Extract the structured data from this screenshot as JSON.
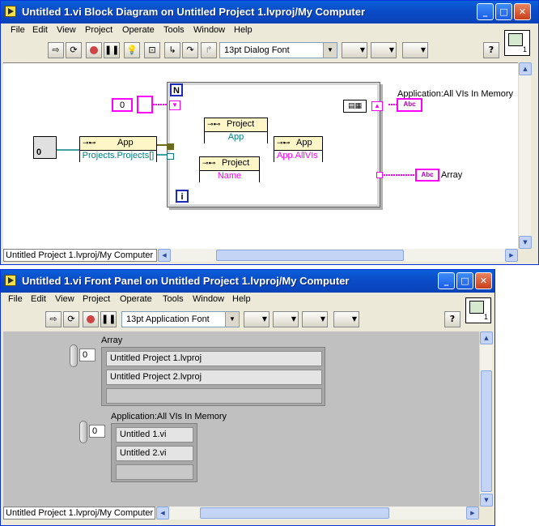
{
  "block_diagram_window": {
    "title": "Untitled 1.vi Block Diagram on Untitled Project 1.lvproj/My Computer",
    "menu": [
      "File",
      "Edit",
      "View",
      "Project",
      "Operate",
      "Tools",
      "Window",
      "Help"
    ],
    "font_select": "13pt Dialog Font",
    "vi_icon_number": "1",
    "status": "Untitled Project 1.lvproj/My Computer",
    "diagram": {
      "numeric_constant": "0",
      "app_node": {
        "class": "App",
        "property": "Projects.Projects[]"
      },
      "project_node_1": {
        "class": "Project",
        "property": "App"
      },
      "app_node_2": {
        "class": "App",
        "property": "App.AllVIs"
      },
      "project_node_2": {
        "class": "Project",
        "property": "Name"
      },
      "loop_count_terminal": "N",
      "loop_iteration_terminal": "i",
      "indicator_label_1": "Application:All VIs In Memory",
      "indicator_label_2": "Array",
      "string_indicator_text": "Abc",
      "app_ref_constant": "0"
    }
  },
  "front_panel_window": {
    "title": "Untitled 1.vi Front Panel on Untitled Project 1.lvproj/My Computer",
    "menu": [
      "File",
      "Edit",
      "View",
      "Project",
      "Operate",
      "Tools",
      "Window",
      "Help"
    ],
    "font_select": "13pt Application Font",
    "vi_icon_number": "1",
    "status": "Untitled Project 1.lvproj/My Computer",
    "array1": {
      "label": "Array",
      "index": "0",
      "elements": [
        "Untitled Project 1.lvproj",
        "Untitled Project 2.lvproj",
        ""
      ]
    },
    "array2": {
      "label": "Application:All VIs In Memory",
      "index": "0",
      "elements": [
        "Untitled 1.vi",
        "Untitled 2.vi",
        ""
      ]
    }
  },
  "icons": {
    "run": "run-arrow-icon",
    "run_continuous": "run-continuously-icon",
    "abort": "abort-icon",
    "pause": "pause-icon",
    "highlight": "highlight-execution-icon",
    "retain": "retain-wire-values-icon",
    "step_into": "step-into-icon",
    "step_over": "step-over-icon",
    "step_out": "step-out-icon",
    "help": "help-icon",
    "align": "align-objects-icon",
    "distribute": "distribute-objects-icon",
    "resize": "resize-objects-icon",
    "reorder": "reorder-icon"
  },
  "colors": {
    "title_bar": "#0a5fd8",
    "string_wire": "#ff00ff",
    "refnum_wire": "#008080",
    "fp_background": "#c0c0c0",
    "property_node": "#fff6c8"
  }
}
